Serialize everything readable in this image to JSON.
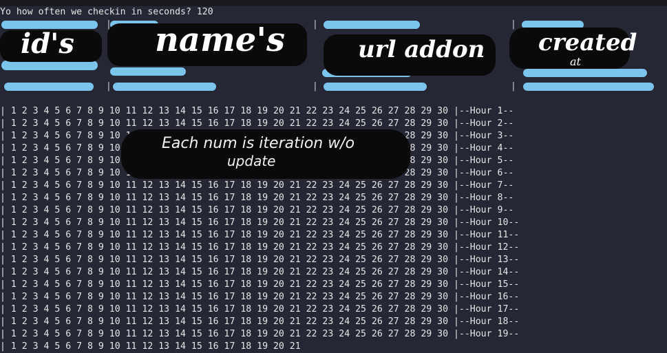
{
  "prompt_line": "Yo how often we checkin in seconds? 120",
  "labels": {
    "ids": "id's",
    "names": "name's",
    "url": "url addon",
    "created": "created",
    "created_sub": "at",
    "annotation_line1": "Each num is iteration w/o",
    "annotation_line2": "update"
  },
  "table_seps": [
    "|",
    "|",
    "|",
    "|",
    "|",
    "|"
  ],
  "counter_rows": [
    "| 1 2 3 4 5 6 7 8 9 10 11 12 13 14 15 16 17 18 19 20 21 22 23 24 25 26 27 28 29 30 |--Hour 1--",
    "| 1 2 3 4 5 6 7 8 9 10 11 12 13 14 15 16 17 18 19 20 21 22 23 24 25 26 27 28 29 30 |--Hour 2--",
    "| 1 2 3 4 5 6 7 8 9 10 11 12 13 14 15 16 17 18 19 20 21 22 23 24 25 26 27 28 29 30 |--Hour 3--",
    "| 1 2 3 4 5 6 7 8 9 10 11 12 13 14 15 16 17 18 19 20 21 22 23 24 25 26 27 28 29 30 |--Hour 4--",
    "| 1 2 3 4 5 6 7 8 9 10 11 12 13 14 15 16 17 18 19 20 21 22 23 24 25 26 27 28 29 30 |--Hour 5--",
    "| 1 2 3 4 5 6 7 8 9 10 11 12 13 14 15 16 17 18 19 20 21 22 23 24 25 26 27 28 29 30 |--Hour 6--",
    "| 1 2 3 4 5 6 7 8 9 10 11 12 13 14 15 16 17 18 19 20 21 22 23 24 25 26 27 28 29 30 |--Hour 7--",
    "| 1 2 3 4 5 6 7 8 9 10 11 12 13 14 15 16 17 18 19 20 21 22 23 24 25 26 27 28 29 30 |--Hour 8--",
    "| 1 2 3 4 5 6 7 8 9 10 11 12 13 14 15 16 17 18 19 20 21 22 23 24 25 26 27 28 29 30 |--Hour 9--",
    "| 1 2 3 4 5 6 7 8 9 10 11 12 13 14 15 16 17 18 19 20 21 22 23 24 25 26 27 28 29 30 |--Hour 10--",
    "| 1 2 3 4 5 6 7 8 9 10 11 12 13 14 15 16 17 18 19 20 21 22 23 24 25 26 27 28 29 30 |--Hour 11--",
    "| 1 2 3 4 5 6 7 8 9 10 11 12 13 14 15 16 17 18 19 20 21 22 23 24 25 26 27 28 29 30 |--Hour 12--",
    "| 1 2 3 4 5 6 7 8 9 10 11 12 13 14 15 16 17 18 19 20 21 22 23 24 25 26 27 28 29 30 |--Hour 13--",
    "| 1 2 3 4 5 6 7 8 9 10 11 12 13 14 15 16 17 18 19 20 21 22 23 24 25 26 27 28 29 30 |--Hour 14--",
    "| 1 2 3 4 5 6 7 8 9 10 11 12 13 14 15 16 17 18 19 20 21 22 23 24 25 26 27 28 29 30 |--Hour 15--",
    "| 1 2 3 4 5 6 7 8 9 10 11 12 13 14 15 16 17 18 19 20 21 22 23 24 25 26 27 28 29 30 |--Hour 16--",
    "| 1 2 3 4 5 6 7 8 9 10 11 12 13 14 15 16 17 18 19 20 21 22 23 24 25 26 27 28 29 30 |--Hour 17--",
    "| 1 2 3 4 5 6 7 8 9 10 11 12 13 14 15 16 17 18 19 20 21 22 23 24 25 26 27 28 29 30 |--Hour 18--",
    "| 1 2 3 4 5 6 7 8 9 10 11 12 13 14 15 16 17 18 19 20 21 22 23 24 25 26 27 28 29 30 |--Hour 19--",
    "| 1 2 3 4 5 6 7 8 9 10 11 12 13 14 15 16 17 18 19 20 21"
  ]
}
